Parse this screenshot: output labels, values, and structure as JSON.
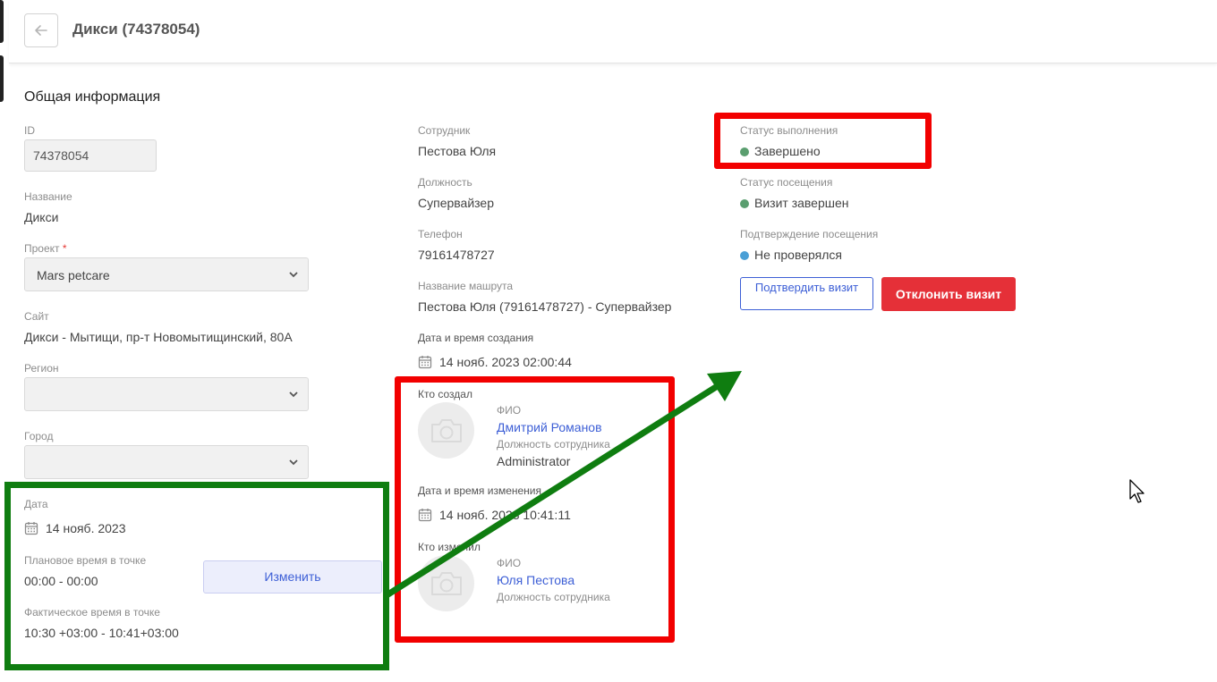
{
  "header": {
    "title": "Дикси (74378054)"
  },
  "general": {
    "section_title": "Общая информация",
    "id_label": "ID",
    "id_value": "74378054",
    "name_label": "Название",
    "name_value": "Дикси",
    "project_label": "Проект",
    "project_required_mark": "*",
    "project_value": "Mars petcare",
    "site_label": "Сайт",
    "site_value": "Дикси - Мытищи, пр-т Новомытищинский, 80А",
    "region_label": "Регион",
    "region_value": "",
    "city_label": "Город",
    "city_value": "",
    "date_label": "Дата",
    "date_value": "14 нояб. 2023",
    "planned_time_label": "Плановое время в точке",
    "planned_time_value": "00:00 - 00:00",
    "change_button": "Изменить",
    "actual_time_label": "Фактическое время в точке",
    "actual_time_value": "10:30 +03:00 - 10:41+03:00"
  },
  "employee": {
    "employee_label": "Сотрудник",
    "employee_value": "Пестова Юля",
    "position_label": "Должность",
    "position_value": "Супервайзер",
    "phone_label": "Телефон",
    "phone_value": "79161478727",
    "route_label": "Название машрута",
    "route_value": "Пестова Юля (79161478727) - Супервайзер",
    "created_at_label": "Дата и время создания",
    "created_at_value": "14 нояб. 2023 02:00:44",
    "created_by_label": "Кто создал",
    "creator_fio_label": "ФИО",
    "creator_name": "Дмитрий Романов",
    "creator_position_label": "Должность сотрудника",
    "creator_position_value": "Administrator",
    "modified_at_label": "Дата и время изменения",
    "modified_at_value": "14 нояб. 2023 10:41:11",
    "modified_by_label": "Кто изменил",
    "modifier_fio_label": "ФИО",
    "modifier_name": "Юля Пестова",
    "modifier_position_label": "Должность сотрудника"
  },
  "status": {
    "execution_label": "Статус выполнения",
    "execution_value": "Завершено",
    "visit_label": "Статус посещения",
    "visit_value": "Визит завершен",
    "confirmation_label": "Подтверждение посещения",
    "confirmation_value": "Не проверялся",
    "confirm_button": "Подтвердить визит",
    "reject_button": "Отклонить визит"
  },
  "colors": {
    "status_green": "#5a9e6f",
    "status_blue": "#4a9fd6",
    "link_blue": "#3d5fd6",
    "reject_red": "#e53038",
    "highlight_red": "#f20000",
    "highlight_green": "#0f7d10"
  },
  "icons": [
    "arrow-left-icon",
    "chevron-down-icon",
    "calendar-icon",
    "camera-icon",
    "mouse-cursor-icon"
  ]
}
